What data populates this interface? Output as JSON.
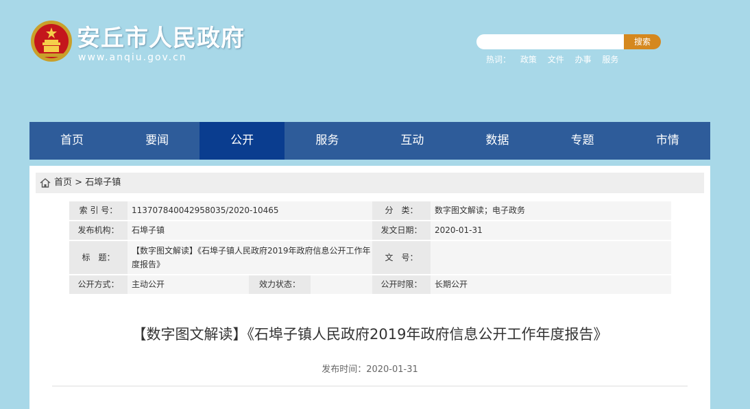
{
  "header": {
    "site_title": "安丘市人民政府",
    "site_url": "www.anqiu.gov.cn",
    "search_placeholder": "",
    "search_button": "搜索",
    "hotwords_label": "热词：",
    "hotwords": [
      "政策",
      "文件",
      "办事",
      "服务"
    ]
  },
  "nav": {
    "items": [
      "首页",
      "要闻",
      "公开",
      "服务",
      "互动",
      "数据",
      "专题",
      "市情"
    ],
    "active": "公开"
  },
  "breadcrumb": {
    "home": "首页",
    "separator": ">",
    "current": "石埠子镇"
  },
  "meta": {
    "index_no_label": "索 引 号：",
    "index_no": "113707840042958035/2020-10465",
    "category_label": "分　类：",
    "category": "数字图文解读；电子政务",
    "publisher_label": "发布机构：",
    "publisher": "石埠子镇",
    "issue_date_label": "发文日期：",
    "issue_date": "2020-01-31",
    "title_label": "标　题：",
    "title": "【数字图文解读】《石埠子镇人民政府2019年政府信息公开工作年度报告》",
    "doc_no_label": "文　号：",
    "doc_no": "",
    "disclosure_method_label": "公开方式：",
    "disclosure_method": "主动公开",
    "validity_label": "效力状态：",
    "validity": "",
    "disclosure_period_label": "公开时限：",
    "disclosure_period": "长期公开"
  },
  "article": {
    "title": "【数字图文解读】《石埠子镇人民政府2019年政府信息公开工作年度报告》",
    "pub_date_label": "发布时间：",
    "pub_date": "2020-01-31"
  },
  "colors": {
    "background": "#a8d8e8",
    "nav": "#2e5c9a",
    "nav_active": "#0a3d8f",
    "search_button": "#d5881e"
  }
}
